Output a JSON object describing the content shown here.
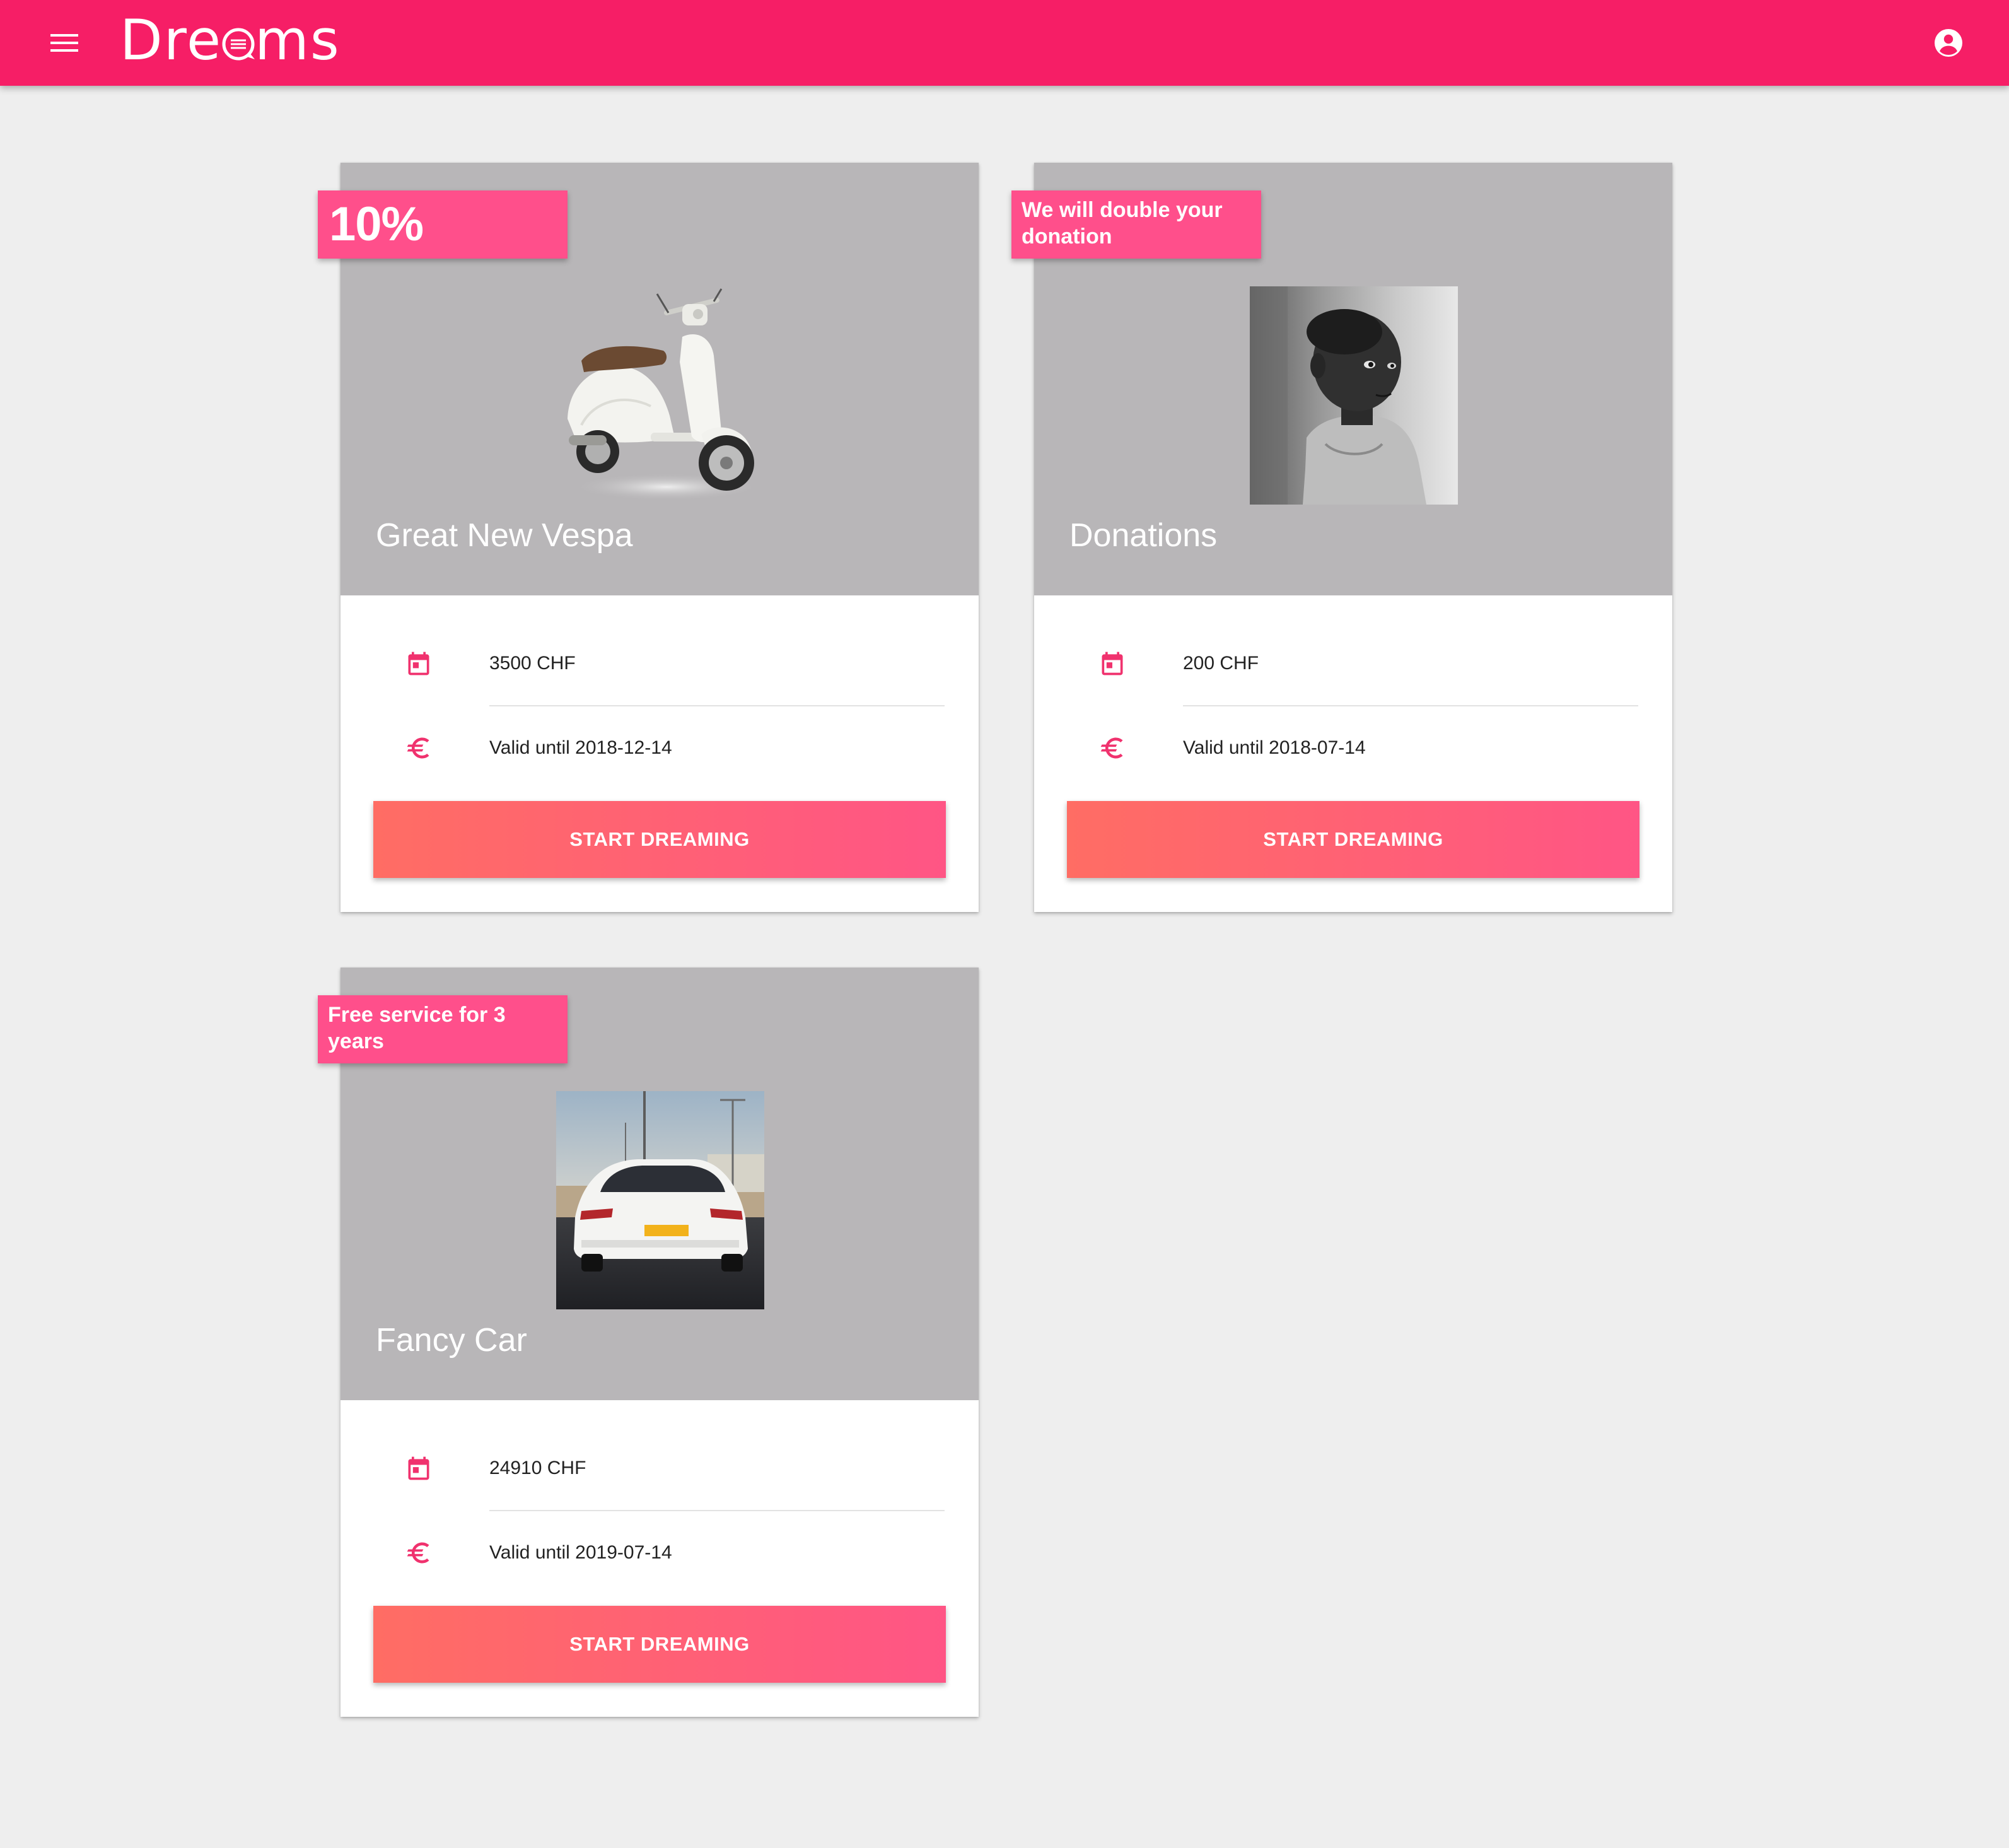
{
  "header": {
    "menu_icon": "menu-icon",
    "logo_left": "Dre",
    "logo_right": "ms",
    "account_icon": "account-circle-icon",
    "background_color": "#f61e66"
  },
  "cards": [
    {
      "badge": "10%",
      "title": "Great New Vespa",
      "amount": "3500 CHF",
      "validity": "Valid until 2018-12-14",
      "button": "START DREAMING",
      "image": "vespa-scooter-image",
      "amount_icon": "calendar-icon",
      "validity_icon": "euro-icon"
    },
    {
      "badge": "We will double your donation",
      "title": "Donations",
      "amount": "200 CHF",
      "validity": "Valid until 2018-07-14",
      "button": "START DREAMING",
      "image": "child-photo-image",
      "amount_icon": "calendar-icon",
      "validity_icon": "euro-icon"
    },
    {
      "badge": "Free service for 3 years",
      "title": "Fancy Car",
      "amount": "24910 CHF",
      "validity": "Valid until 2019-07-14",
      "button": "START DREAMING",
      "image": "white-car-image",
      "amount_icon": "calendar-icon",
      "validity_icon": "euro-icon"
    }
  ],
  "colors": {
    "accent": "#ff4f8b",
    "icon": "#f0326e",
    "media_background": "#b8b6b8",
    "page_background": "#eeeeee"
  }
}
